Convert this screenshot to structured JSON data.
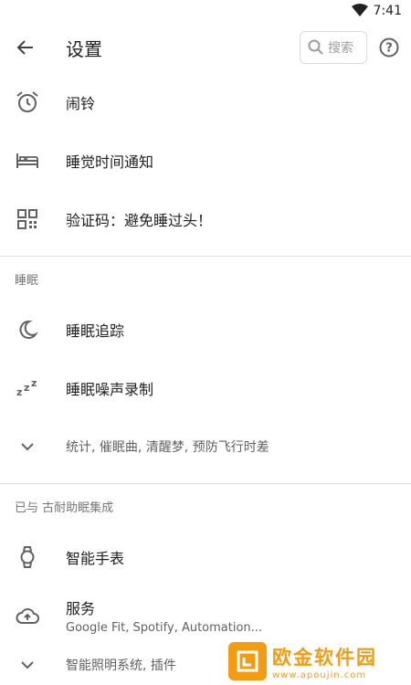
{
  "status": {
    "time": "7:41"
  },
  "header": {
    "title": "设置",
    "search_placeholder": "搜索"
  },
  "items": {
    "alarm": "闹铃",
    "bedtime": "睡觉时间通知",
    "captcha": "验证码：避免睡过头！"
  },
  "sleep_section": {
    "title": "睡眠",
    "tracking": "睡眠追踪",
    "noise": "睡眠噪声录制",
    "more": "统计, 催眠曲, 清醒梦, 预防飞行时差"
  },
  "integration_section": {
    "title": "已与 古耐助眠集成",
    "watch": "智能手表",
    "services": "服务",
    "services_sub": "Google Fit, Spotify, Automation...",
    "more": "智能照明系统, 插件"
  },
  "watermark": {
    "name": "欧金软件园",
    "url": "www.apoujin.com"
  },
  "colors": {
    "accent": "#f39c12",
    "icon": "#616161",
    "divider": "#dcdcdc"
  }
}
